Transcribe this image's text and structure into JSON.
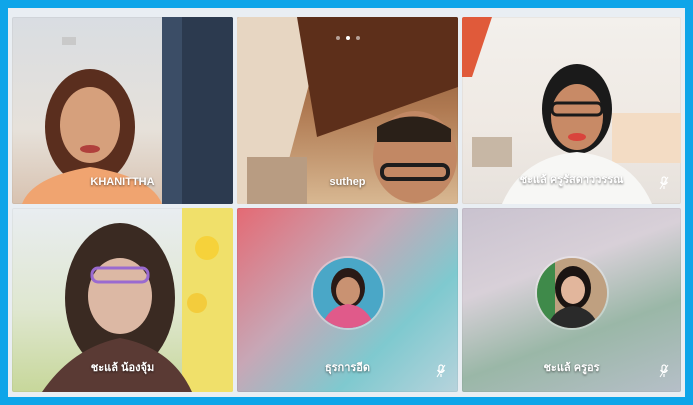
{
  "call": {
    "page_indicator": {
      "count": 3,
      "active": 2
    },
    "participants": [
      {
        "name": "KHANITTHA",
        "video": true
      },
      {
        "name": "suthep",
        "video": true
      },
      {
        "name": "ชะแล้ ครูรัสดาววรรณ",
        "video": true,
        "mic_icon": "mic-icon"
      },
      {
        "name": "ชะแล้ น้องจุ้ม",
        "video": true
      },
      {
        "name": "ธุรการอีด",
        "video": false,
        "mic_icon": "mic-icon"
      },
      {
        "name": "ชะแล้ ครูอร",
        "video": false,
        "mic_icon": "mic-icon"
      }
    ]
  },
  "colors": {
    "frame_border": "#0ea5e9",
    "name_text": "#ffffff"
  }
}
